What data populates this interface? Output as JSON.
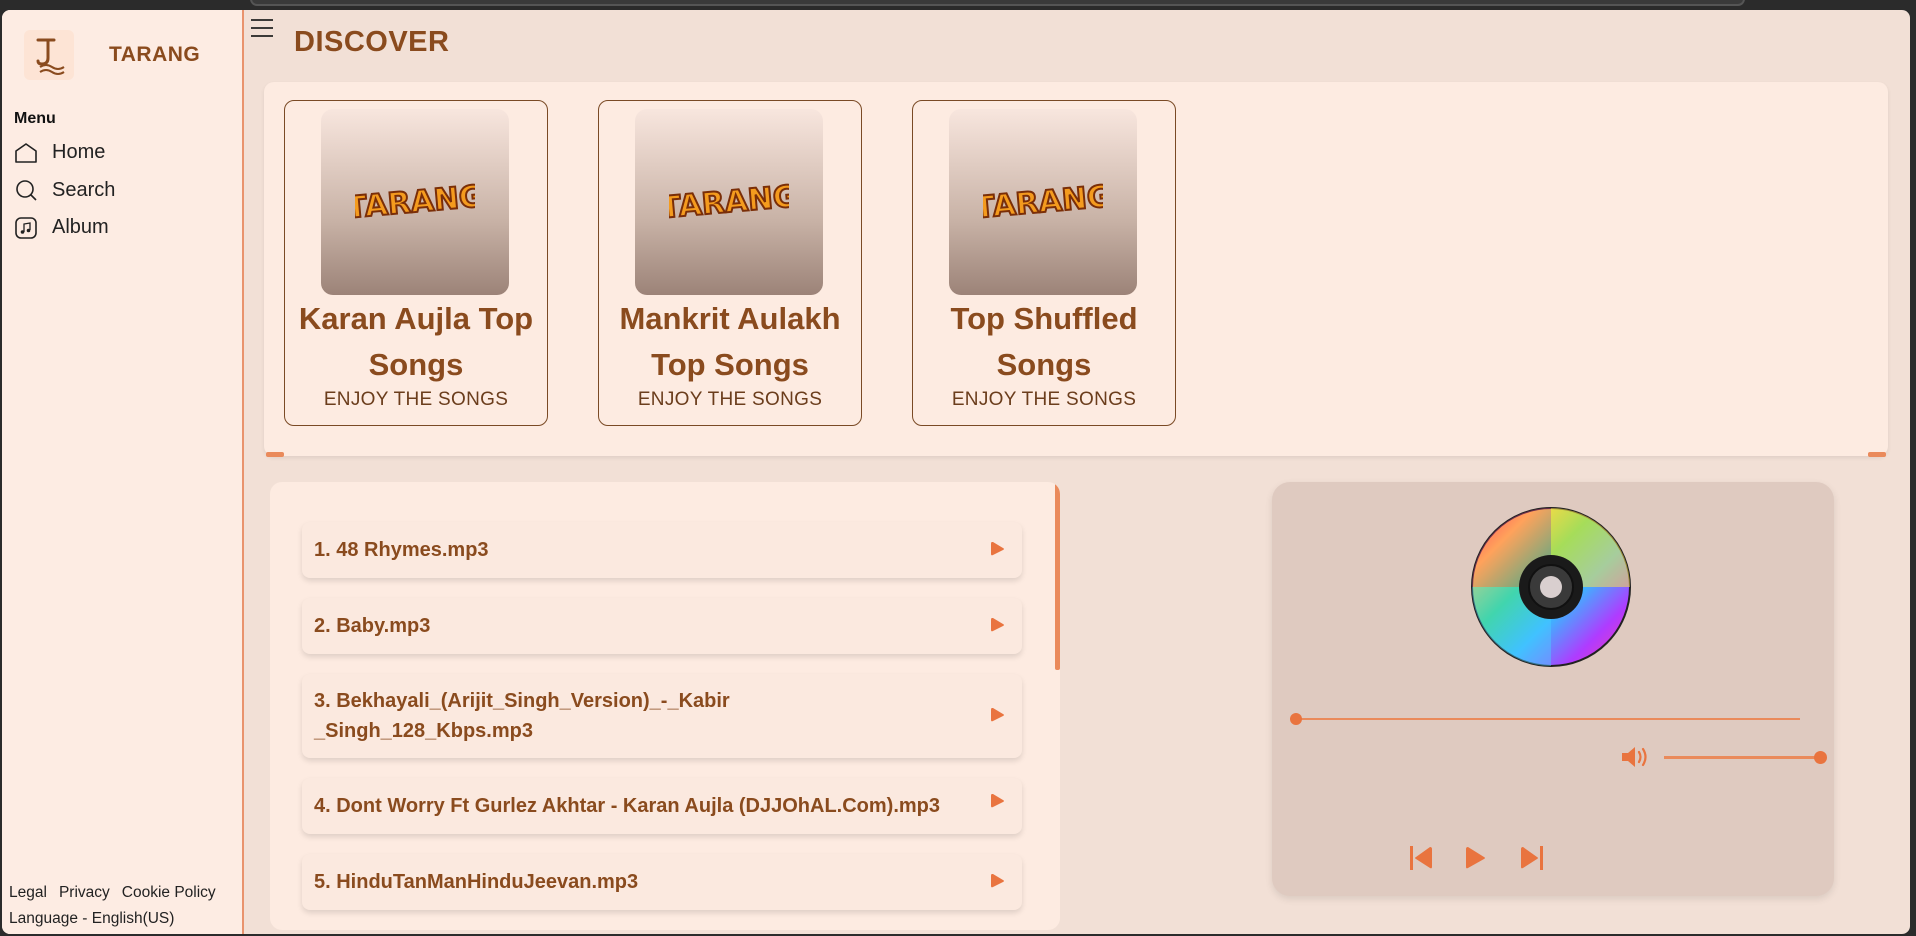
{
  "app": {
    "name": "TARANG"
  },
  "sidebar": {
    "menu_title": "Menu",
    "items": [
      {
        "label": "Home",
        "icon": "home-icon"
      },
      {
        "label": "Search",
        "icon": "search-icon"
      },
      {
        "label": "Album",
        "icon": "album-icon"
      }
    ],
    "footer": {
      "legal": "Legal",
      "privacy": "Privacy",
      "cookie": "Cookie Policy",
      "language": "Language - English(US)"
    }
  },
  "main": {
    "title": "DISCOVER",
    "cards": [
      {
        "title": "Karan Aujla Top Songs",
        "subtitle": "ENJOY THE SONGS",
        "art_text": "TARANG"
      },
      {
        "title": "Mankrit Aulakh Top Songs",
        "subtitle": "ENJOY THE SONGS",
        "art_text": "TARANG"
      },
      {
        "title": "Top Shuffled Songs",
        "subtitle": "ENJOY THE SONGS",
        "art_text": "TARANG"
      }
    ],
    "songs": [
      "1. 48 Rhymes.mp3",
      "2. Baby.mp3",
      "3. Bekhayali_(Arijit_Singh_Version)_-_Kabir_Singh_128_Kbps.mp3",
      "4. Dont Worry Ft Gurlez Akhtar - Karan Aujla (DJJOhAL.Com).mp3",
      "5. HinduTanManHinduJeevan.mp3"
    ]
  },
  "player": {
    "progress": 0.0,
    "volume": 1.0
  },
  "colors": {
    "accent": "#e9743f",
    "brand_text": "#8a4b1e",
    "sidebar_bg": "#fdece3",
    "page_bg": "#f2e0d6",
    "player_bg": "#dfcac0"
  }
}
